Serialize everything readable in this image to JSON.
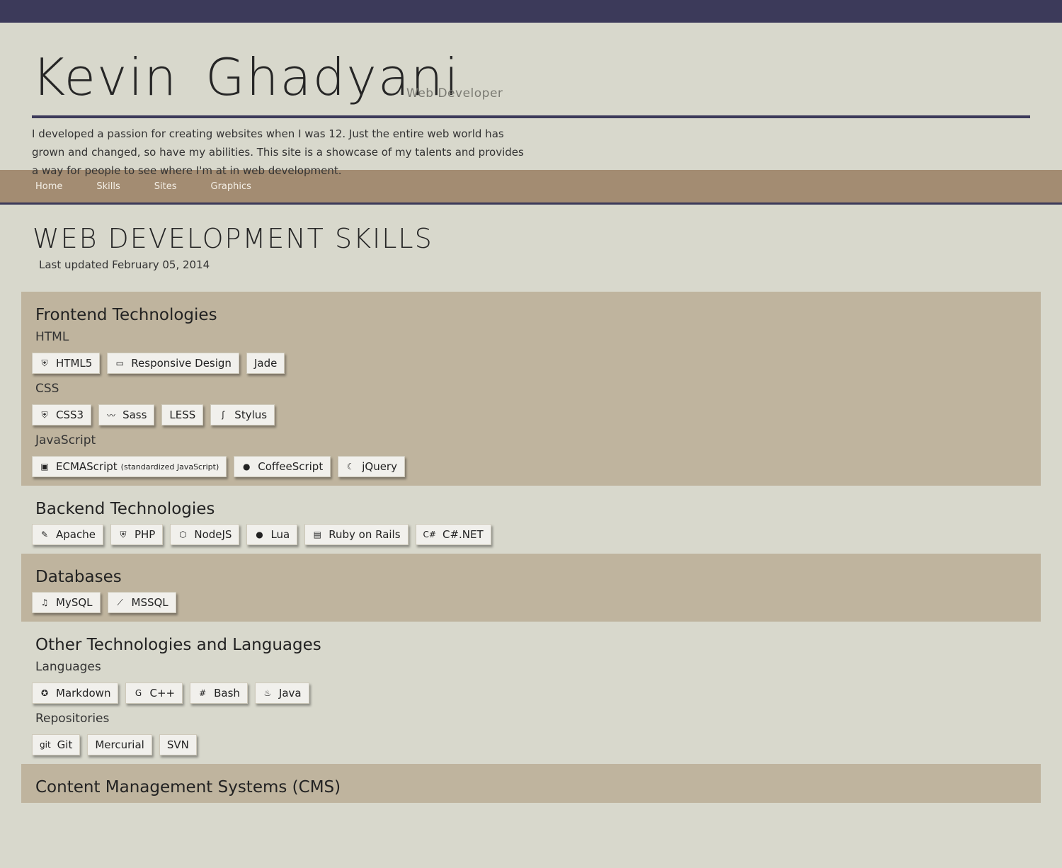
{
  "header": {
    "title": "Kevin Ghadyani",
    "subtitle": "Web Developer",
    "intro": "I developed a passion for creating websites when I was 12. Just the entire web world has grown and changed, so have my abilities. This site is a showcase of my talents and provides a way for people to see where I'm at in web development."
  },
  "nav": [
    "Home",
    "Skills",
    "Sites",
    "Graphics"
  ],
  "page": {
    "title": "WEB DEVELOPMENT SKILLS",
    "last_updated": "Last updated February 05, 2014"
  },
  "sections": [
    {
      "title": "Frontend Technologies",
      "groups": [
        {
          "label": "HTML",
          "tags": [
            {
              "name": "HTML5",
              "icon": "html5-icon",
              "glyph": "⛨"
            },
            {
              "name": "Responsive Design",
              "icon": "responsive-icon",
              "glyph": "▭"
            },
            {
              "name": "Jade",
              "icon": "",
              "glyph": ""
            }
          ]
        },
        {
          "label": "CSS",
          "tags": [
            {
              "name": "CSS3",
              "icon": "css3-icon",
              "glyph": "⛨"
            },
            {
              "name": "Sass",
              "icon": "sass-icon",
              "glyph": "〰"
            },
            {
              "name": "LESS",
              "icon": "",
              "glyph": ""
            },
            {
              "name": "Stylus",
              "icon": "stylus-icon",
              "glyph": "ʃ"
            }
          ]
        },
        {
          "label": "JavaScript",
          "tags": [
            {
              "name": "ECMAScript",
              "note": "(standardized JavaScript)",
              "icon": "js-icon",
              "glyph": "▣"
            },
            {
              "name": "CoffeeScript",
              "icon": "coffeescript-icon",
              "glyph": "●"
            },
            {
              "name": "jQuery",
              "icon": "jquery-icon",
              "glyph": "☾"
            }
          ]
        }
      ]
    },
    {
      "title": "Backend Technologies",
      "groups": [
        {
          "label": "",
          "tags": [
            {
              "name": "Apache",
              "icon": "apache-feather-icon",
              "glyph": "✎"
            },
            {
              "name": "PHP",
              "icon": "php-icon",
              "glyph": "⛨"
            },
            {
              "name": "NodeJS",
              "icon": "nodejs-icon",
              "glyph": "⬡"
            },
            {
              "name": "Lua",
              "icon": "lua-icon",
              "glyph": "●"
            },
            {
              "name": "Ruby on Rails",
              "icon": "rails-icon",
              "glyph": "▤"
            },
            {
              "name": "C#.NET",
              "icon": "csharp-icon",
              "glyph": "C#"
            }
          ]
        }
      ]
    },
    {
      "title": "Databases",
      "groups": [
        {
          "label": "",
          "tags": [
            {
              "name": "MySQL",
              "icon": "mysql-icon",
              "glyph": "♫"
            },
            {
              "name": "MSSQL",
              "icon": "mssql-icon",
              "glyph": "⟋"
            }
          ]
        }
      ]
    },
    {
      "title": "Other Technologies and Languages",
      "groups": [
        {
          "label": "Languages",
          "tags": [
            {
              "name": "Markdown",
              "icon": "markdown-icon",
              "glyph": "✪"
            },
            {
              "name": "C++",
              "icon": "cplusplus-icon",
              "glyph": "G"
            },
            {
              "name": "Bash",
              "icon": "bash-icon",
              "glyph": "#"
            },
            {
              "name": "Java",
              "icon": "java-icon",
              "glyph": "♨"
            }
          ]
        },
        {
          "label": "Repositories",
          "tags": [
            {
              "name": "Git",
              "icon": "git-icon",
              "glyph": "git"
            },
            {
              "name": "Mercurial",
              "icon": "",
              "glyph": ""
            },
            {
              "name": "SVN",
              "icon": "",
              "glyph": ""
            }
          ]
        }
      ]
    },
    {
      "title": "Content Management Systems (CMS)",
      "groups": []
    }
  ]
}
